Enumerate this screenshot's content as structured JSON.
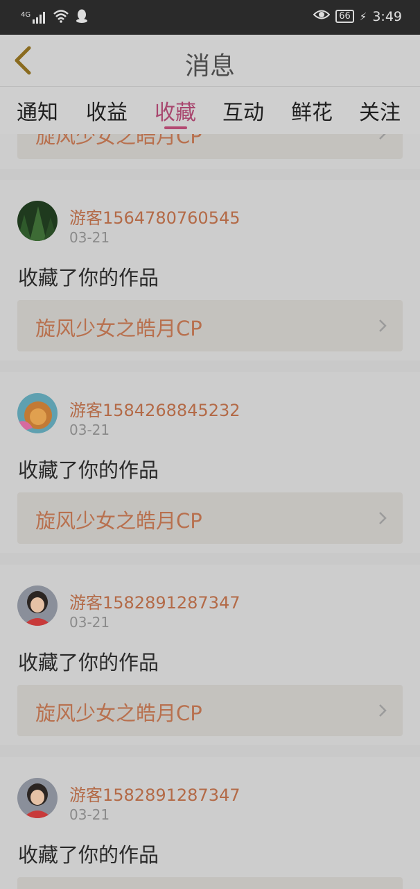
{
  "status_bar": {
    "signal": "4G",
    "battery": "66",
    "time": "3:49"
  },
  "header": {
    "title": "消息"
  },
  "tabs": [
    {
      "label": "通知"
    },
    {
      "label": "收益"
    },
    {
      "label": "收藏",
      "active": true
    },
    {
      "label": "互动"
    },
    {
      "label": "鲜花"
    },
    {
      "label": "关注"
    }
  ],
  "partial_item": {
    "work_title": "旋风少女之皓月CP"
  },
  "items": [
    {
      "user": "游客1564780760545",
      "date": "03-21",
      "message": "收藏了你的作品",
      "work_title": "旋风少女之皓月CP",
      "avatar": "forest-avatar"
    },
    {
      "user": "游客1584268845232",
      "date": "03-21",
      "message": "收藏了你的作品",
      "work_title": "旋风少女之皓月CP",
      "avatar": "lion-avatar"
    },
    {
      "user": "游客1582891287347",
      "date": "03-21",
      "message": "收藏了你的作品",
      "work_title": "旋风少女之皓月CP",
      "avatar": "girl-avatar"
    },
    {
      "user": "游客1582891287347",
      "date": "03-21",
      "message": "收藏了你的作品",
      "avatar": "girl-avatar"
    }
  ],
  "colors": {
    "accent": "#b34a72",
    "link": "#b8704e",
    "username": "#b36a47"
  }
}
